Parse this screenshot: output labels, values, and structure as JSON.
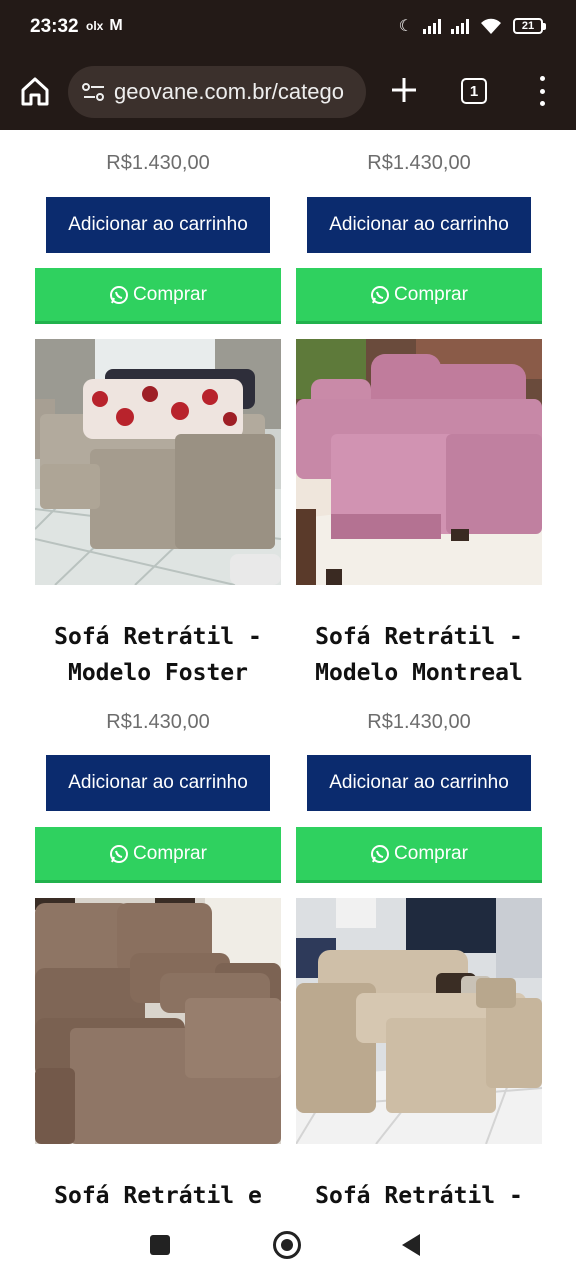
{
  "status_bar": {
    "time": "23:32",
    "notif_olx": "olx",
    "notif_mail": "M",
    "battery": "21"
  },
  "browser": {
    "url": "geovane.com.br/catego",
    "tab_count": "1"
  },
  "products": [
    {
      "title_lines": [
        "",
        ""
      ],
      "price": "R$1.430,00",
      "cart_label": "Adicionar ao carrinho",
      "buy_label": "Comprar"
    },
    {
      "title_lines": [
        "",
        ""
      ],
      "price": "R$1.430,00",
      "cart_label": "Adicionar ao carrinho",
      "buy_label": "Comprar"
    },
    {
      "title_lines": [
        "Sofá Retrátil -",
        "Modelo Foster"
      ],
      "price": "R$1.430,00",
      "cart_label": "Adicionar ao carrinho",
      "buy_label": "Comprar",
      "image": "sofa-gray-floral-pillows"
    },
    {
      "title_lines": [
        "Sofá Retrátil -",
        "Modelo Montreal"
      ],
      "price": "R$1.430,00",
      "cart_label": "Adicionar ao carrinho",
      "buy_label": "Comprar",
      "image": "sofa-pink"
    },
    {
      "title_lines": [
        "Sofá Retrátil e",
        ""
      ],
      "image": "sofa-brown"
    },
    {
      "title_lines": [
        "Sofá Retrátil -",
        ""
      ],
      "image": "sofa-beige"
    }
  ],
  "colors": {
    "chrome_bg": "#231a17",
    "cart_button": "#0b2b6e",
    "buy_button": "#2fd15f"
  }
}
